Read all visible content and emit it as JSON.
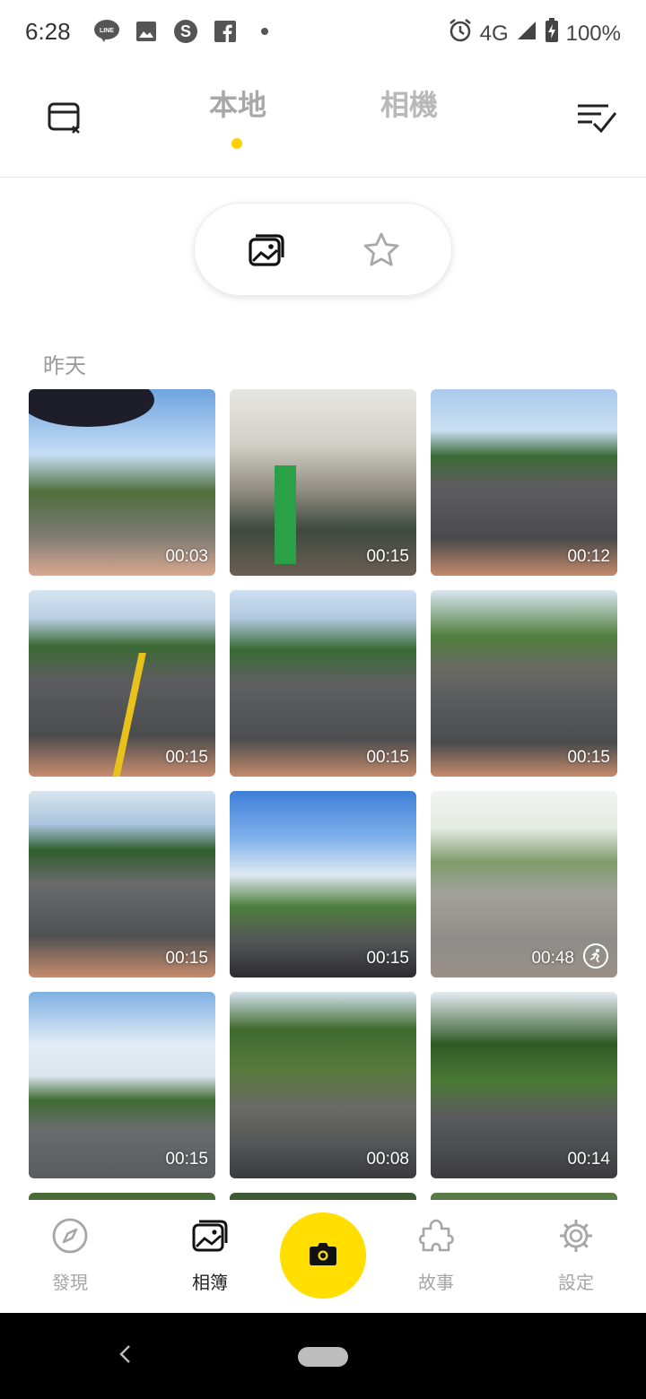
{
  "status_bar": {
    "time": "6:28",
    "network": "4G",
    "battery": "100%",
    "left_icons": [
      "line-icon",
      "image-icon",
      "skype-icon",
      "facebook-icon",
      "dot-icon"
    ],
    "right_icons": [
      "alarm-icon",
      "signal-icon",
      "battery-icon"
    ]
  },
  "top_nav": {
    "tabs": [
      {
        "label": "本地",
        "active": true
      },
      {
        "label": "相機",
        "active": false
      }
    ],
    "left_icon": "card-remove-icon",
    "right_icon": "select-list-icon",
    "active_indicator_color": "#ffd200"
  },
  "segment": {
    "options": [
      "album-icon",
      "star-icon"
    ],
    "selected": "album-icon"
  },
  "section": {
    "label": "昨天"
  },
  "thumbnails": [
    {
      "duration": "00:03"
    },
    {
      "duration": "00:15"
    },
    {
      "duration": "00:12"
    },
    {
      "duration": "00:15"
    },
    {
      "duration": "00:15"
    },
    {
      "duration": "00:15"
    },
    {
      "duration": "00:15"
    },
    {
      "duration": "00:15"
    },
    {
      "duration": "00:48",
      "timelapse": true
    },
    {
      "duration": "00:15"
    },
    {
      "duration": "00:08"
    },
    {
      "duration": "00:14"
    }
  ],
  "bottom_nav": {
    "items": [
      {
        "label": "發現",
        "icon": "compass-icon",
        "active": false
      },
      {
        "label": "相簿",
        "icon": "album-icon",
        "active": true
      },
      {
        "label": "故事",
        "icon": "puzzle-icon",
        "active": false
      },
      {
        "label": "設定",
        "icon": "gear-icon",
        "active": false
      }
    ],
    "camera_icon": "camera-icon",
    "camera_color": "#ffde00"
  }
}
